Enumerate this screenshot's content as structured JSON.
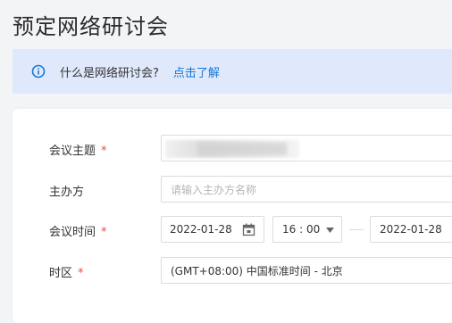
{
  "page": {
    "title": "预定网络研讨会"
  },
  "banner": {
    "icon": "info-circle-icon",
    "text": "什么是网络研讨会?",
    "link": "点击了解",
    "accent": "#1677d8",
    "background": "#dfe9fb"
  },
  "form": {
    "topic": {
      "label": "会议主题",
      "required_mark": "*",
      "value": ""
    },
    "host": {
      "label": "主办方",
      "placeholder": "请输入主办方名称"
    },
    "time": {
      "label": "会议时间",
      "required_mark": "*",
      "start_date": "2022-01-28",
      "start_time": "16 : 00",
      "end_date": "2022-01-28",
      "date_icon": "calendar-icon",
      "time_dropdown_icon": "caret-down-icon"
    },
    "timezone": {
      "label": "时区",
      "required_mark": "*",
      "value": "(GMT+08:00) 中国标准时间 - 北京"
    }
  },
  "colors": {
    "required": "#e84b4b",
    "border": "#dcdcdc",
    "page_bg": "#f3f4f6"
  }
}
